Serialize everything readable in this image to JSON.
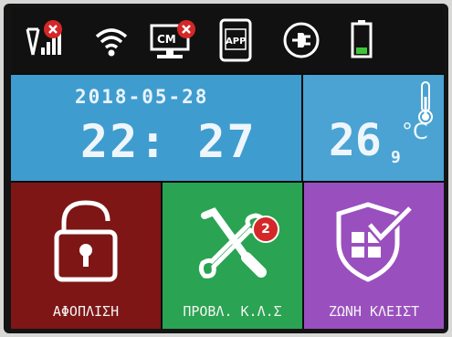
{
  "status_bar": {
    "icons": [
      "signal-strength-icon-with-error",
      "wifi-icon",
      "cms-monitor-icon-with-error",
      "app-phone-icon",
      "power-plug-icon",
      "battery-icon"
    ],
    "cms_label": "CM",
    "app_label": "APP"
  },
  "clock": {
    "date": "2018-05-28",
    "time": "22: 27"
  },
  "temperature": {
    "value": "26",
    "decimal": "9",
    "unit": "°C"
  },
  "tiles": {
    "disarm": {
      "label": "ΑΦΟΠΛΙΣΗ",
      "icon": "open-padlock-icon"
    },
    "fault_check": {
      "label": "ΠΡΟΒΛ. Κ.Λ.Σ",
      "icon": "wrench-screwdriver-icon",
      "badge_count": "2"
    },
    "zone": {
      "label": "ΖΩΝΗ ΚΛΕΙΣΤ",
      "icon": "shield-check-icon"
    }
  },
  "colors": {
    "clock_tile": "#3f9ccf",
    "temp_tile": "#4aa3d2",
    "disarm_tile": "#7e1616",
    "fault_tile": "#2aa352",
    "zone_tile": "#9a4fbf",
    "error_badge": "#d42727"
  }
}
